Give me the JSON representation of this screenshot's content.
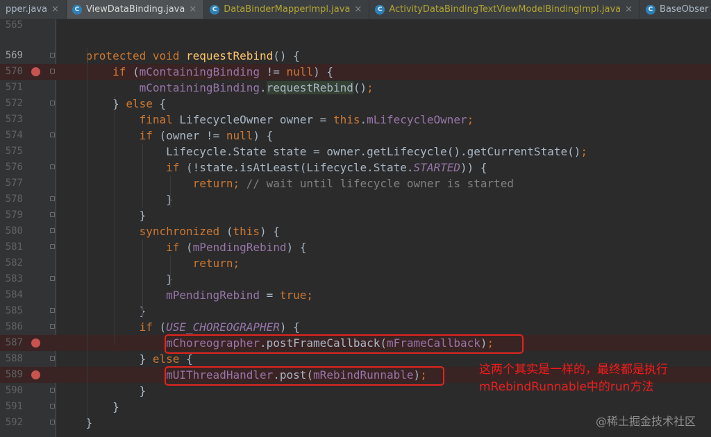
{
  "tabs": [
    {
      "label": "pper.java",
      "icon": "",
      "active": false,
      "modified": false
    },
    {
      "label": "ViewDataBinding.java",
      "icon": "C",
      "active": true,
      "modified": false
    },
    {
      "label": "DataBinderMapperImpl.java",
      "icon": "C",
      "active": false,
      "modified": true
    },
    {
      "label": "ActivityDataBindingTextViewModelBindingImpl.java",
      "icon": "C",
      "active": false,
      "modified": true
    },
    {
      "label": "BaseObser",
      "icon": "C",
      "active": false,
      "modified": false
    }
  ],
  "close_glyph": "×",
  "lines": [
    {
      "num": "565",
      "breakpoint": false,
      "tokens": []
    },
    {
      "num": "",
      "breakpoint": false,
      "tokens": []
    },
    {
      "num": "569",
      "breakpoint": false,
      "tokens": [
        {
          "t": "    "
        },
        {
          "t": "protected void ",
          "c": "kw"
        },
        {
          "t": "requestRebind",
          "c": "fn"
        },
        {
          "t": "() {"
        }
      ]
    },
    {
      "num": "570",
      "breakpoint": true,
      "tokens": [
        {
          "t": "        "
        },
        {
          "t": "if ",
          "c": "kw"
        },
        {
          "t": "("
        },
        {
          "t": "mContainingBinding",
          "c": "fld"
        },
        {
          "t": " != "
        },
        {
          "t": "null",
          "c": "kw"
        },
        {
          "t": ") {"
        }
      ]
    },
    {
      "num": "571",
      "breakpoint": false,
      "tokens": [
        {
          "t": "            "
        },
        {
          "t": "mContainingBinding",
          "c": "fld"
        },
        {
          "t": "."
        },
        {
          "t": "requestRebind",
          "c": "hl"
        },
        {
          "t": "()"
        },
        {
          "t": ";",
          "c": "kw"
        }
      ]
    },
    {
      "num": "572",
      "breakpoint": false,
      "tokens": [
        {
          "t": "        } "
        },
        {
          "t": "else ",
          "c": "kw"
        },
        {
          "t": "{"
        }
      ]
    },
    {
      "num": "573",
      "breakpoint": false,
      "tokens": [
        {
          "t": "            "
        },
        {
          "t": "final ",
          "c": "kw"
        },
        {
          "t": "LifecycleOwner owner = "
        },
        {
          "t": "this",
          "c": "kw"
        },
        {
          "t": "."
        },
        {
          "t": "mLifecycleOwner",
          "c": "fld"
        },
        {
          "t": ";",
          "c": "kw"
        }
      ]
    },
    {
      "num": "574",
      "breakpoint": false,
      "tokens": [
        {
          "t": "            "
        },
        {
          "t": "if ",
          "c": "kw"
        },
        {
          "t": "(owner != "
        },
        {
          "t": "null",
          "c": "kw"
        },
        {
          "t": ") {"
        }
      ]
    },
    {
      "num": "575",
      "breakpoint": false,
      "tokens": [
        {
          "t": "                Lifecycle.State state = owner.getLifecycle().getCurrentState()"
        },
        {
          "t": ";",
          "c": "kw"
        }
      ]
    },
    {
      "num": "576",
      "breakpoint": false,
      "tokens": [
        {
          "t": "                "
        },
        {
          "t": "if ",
          "c": "kw"
        },
        {
          "t": "(!state.isAtLeast(Lifecycle.State."
        },
        {
          "t": "STARTED",
          "c": "fld itl"
        },
        {
          "t": ")) {"
        }
      ]
    },
    {
      "num": "577",
      "breakpoint": false,
      "tokens": [
        {
          "t": "                    "
        },
        {
          "t": "return;",
          "c": "kw"
        },
        {
          "t": " // wait until lifecycle owner is started",
          "c": "cmt"
        }
      ]
    },
    {
      "num": "578",
      "breakpoint": false,
      "tokens": [
        {
          "t": "                }"
        }
      ]
    },
    {
      "num": "579",
      "breakpoint": false,
      "tokens": [
        {
          "t": "            }"
        }
      ]
    },
    {
      "num": "580",
      "breakpoint": false,
      "tokens": [
        {
          "t": "            "
        },
        {
          "t": "synchronized ",
          "c": "kw"
        },
        {
          "t": "("
        },
        {
          "t": "this",
          "c": "kw"
        },
        {
          "t": ") {"
        }
      ]
    },
    {
      "num": "581",
      "breakpoint": false,
      "tokens": [
        {
          "t": "                "
        },
        {
          "t": "if ",
          "c": "kw"
        },
        {
          "t": "("
        },
        {
          "t": "mPendingRebind",
          "c": "fld"
        },
        {
          "t": ") {"
        }
      ]
    },
    {
      "num": "582",
      "breakpoint": false,
      "tokens": [
        {
          "t": "                    "
        },
        {
          "t": "return;",
          "c": "kw"
        }
      ]
    },
    {
      "num": "583",
      "breakpoint": false,
      "tokens": [
        {
          "t": "                }"
        }
      ]
    },
    {
      "num": "584",
      "breakpoint": false,
      "tokens": [
        {
          "t": "                "
        },
        {
          "t": "mPendingRebind",
          "c": "fld"
        },
        {
          "t": " = "
        },
        {
          "t": "true;",
          "c": "kw"
        }
      ]
    },
    {
      "num": "585",
      "breakpoint": false,
      "tokens": [
        {
          "t": "            }"
        }
      ]
    },
    {
      "num": "586",
      "breakpoint": false,
      "tokens": [
        {
          "t": "            "
        },
        {
          "t": "if ",
          "c": "kw"
        },
        {
          "t": "("
        },
        {
          "t": "USE_CHOREOGRAPHER",
          "c": "fld itl"
        },
        {
          "t": ") {"
        }
      ]
    },
    {
      "num": "587",
      "breakpoint": true,
      "tokens": [
        {
          "t": "                "
        },
        {
          "t": "mChoreographer",
          "c": "fld"
        },
        {
          "t": ".postFrameCallback("
        },
        {
          "t": "mFrameCallback",
          "c": "fld"
        },
        {
          "t": ")"
        },
        {
          "t": ";",
          "c": "kw"
        }
      ]
    },
    {
      "num": "588",
      "breakpoint": false,
      "tokens": [
        {
          "t": "            } "
        },
        {
          "t": "else ",
          "c": "kw"
        },
        {
          "t": "{"
        }
      ]
    },
    {
      "num": "589",
      "breakpoint": true,
      "tokens": [
        {
          "t": "                "
        },
        {
          "t": "mUIThreadHandler",
          "c": "fld"
        },
        {
          "t": ".post("
        },
        {
          "t": "mRebindRunnable",
          "c": "fld"
        },
        {
          "t": ")"
        },
        {
          "t": ";",
          "c": "kw"
        }
      ]
    },
    {
      "num": "590",
      "breakpoint": false,
      "tokens": [
        {
          "t": "            }"
        }
      ]
    },
    {
      "num": "591",
      "breakpoint": false,
      "tokens": [
        {
          "t": "        }"
        }
      ]
    },
    {
      "num": "592",
      "breakpoint": false,
      "tokens": [
        {
          "t": "    }"
        }
      ]
    }
  ],
  "annotation": {
    "line1": "这两个其实是一样的，最终都是执行",
    "line2": "mRebindRunnable中的run方法"
  },
  "watermark": "@稀土掘金技术社区"
}
